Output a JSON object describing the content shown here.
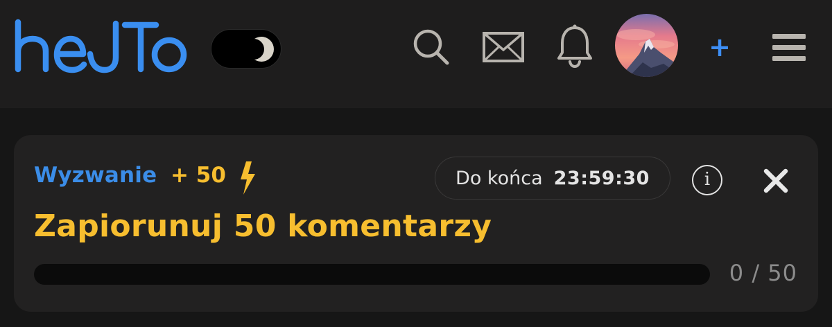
{
  "header": {
    "logo_text": "hejto",
    "theme_toggle": {
      "mode": "dark"
    },
    "icons": {
      "search": "search-icon",
      "messages": "mail-icon",
      "notifications": "bell-icon",
      "add": "plus-icon",
      "menu": "hamburger-menu-icon"
    },
    "add_label": "+"
  },
  "challenge": {
    "type_label": "Wyzwanie",
    "points": "+ 50",
    "timer_label": "Do końca",
    "timer_value": "23:59:30",
    "title": "Zapiorunuj 50 komentarzy",
    "progress": {
      "current": 0,
      "total": 50,
      "text": "0 / 50"
    }
  },
  "colors": {
    "background": "#161616",
    "header": "#1e1d1d",
    "card": "#222121",
    "accent_blue": "#3b8de8",
    "accent_yellow": "#f7be2f",
    "progress_track": "#0b0b0b"
  }
}
